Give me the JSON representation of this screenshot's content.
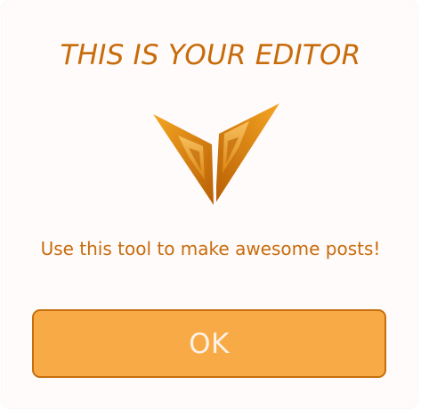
{
  "dialog": {
    "title": "THIS IS YOUR EDITOR",
    "message": "Use this tool to make awesome posts!",
    "ok_label": "OK",
    "logo_icon": "v-wings-logo-icon"
  },
  "colors": {
    "accent": "#c86b0b",
    "button_fill": "#f8aa46",
    "button_border": "#c66f0e",
    "button_text": "#fdf2e6",
    "background": "#fefbfa"
  }
}
